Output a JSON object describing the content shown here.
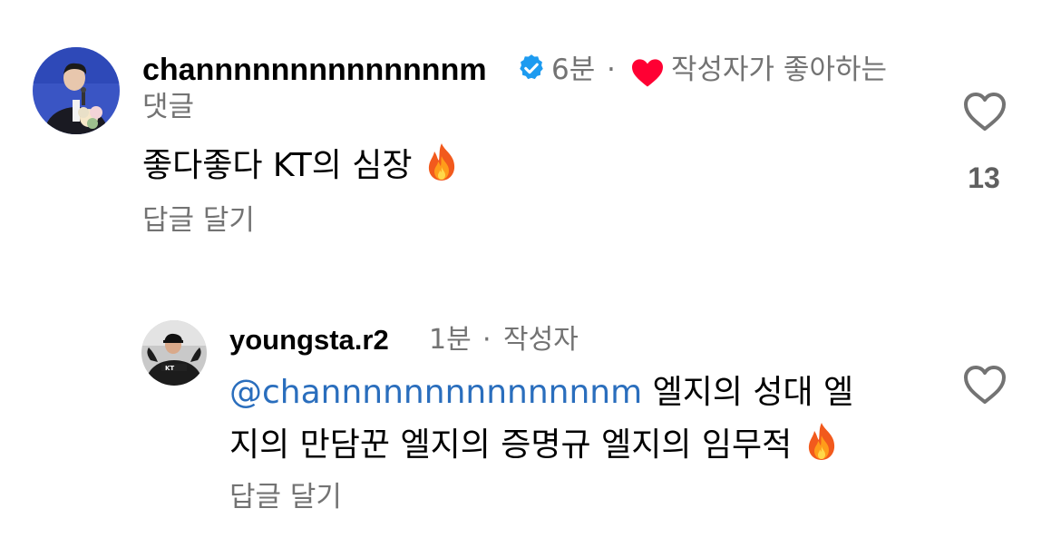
{
  "comments": [
    {
      "username": "channnnnnnnnnnnnnm",
      "verified": true,
      "time": "6분",
      "separator": "·",
      "liked_by_author_label_line1": "작성자가 좋아하는",
      "liked_by_author_label_line2": "댓글",
      "text": "좋다좋다 KT의 심장",
      "emoji": "fire-emoji",
      "reply_label": "답글 달기",
      "like_count": "13"
    },
    {
      "username": "youngsta.r2",
      "time": "1분",
      "separator": "·",
      "author_label": "작성자",
      "mention": "@channnnnnnnnnnnnnm",
      "text_line1": "엘지의 성대 엘",
      "text_line2": "지의 만담꾼 엘지의 증명규 엘지의 임무적",
      "emoji": "fire-emoji",
      "reply_label": "답글 달기"
    }
  ],
  "colors": {
    "verified_badge": "#1d9bf0",
    "liked_heart": "#ff0033",
    "muted_text": "#737373",
    "mention": "#2a6ebd"
  },
  "icons": {
    "like_button": "heart-outline-icon",
    "verified": "verified-badge-icon",
    "author_liked": "heart-filled-icon"
  }
}
